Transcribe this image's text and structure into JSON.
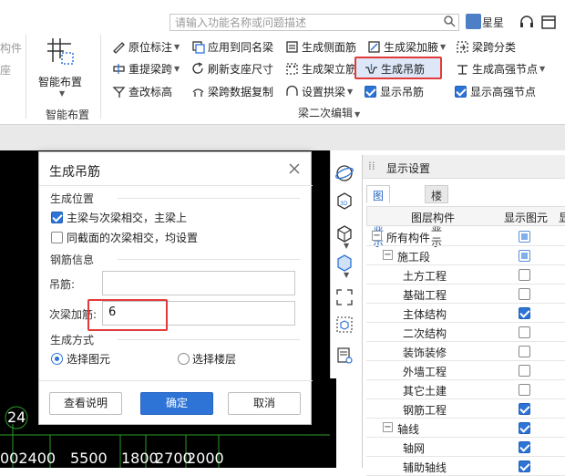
{
  "search": {
    "placeholder": "请输入功能名称或问题描述"
  },
  "user": {
    "name": "星星"
  },
  "ribbon": {
    "left_cut": {
      "line1": "构件",
      "line2": "座"
    },
    "smart_layout": {
      "label": "智能布置",
      "group": "智能布置"
    },
    "col1": [
      "原位标注",
      "重提梁跨",
      "查改标高"
    ],
    "col2": [
      "应用到同名梁",
      "刷新支座尺寸",
      "梁跨数据复制"
    ],
    "col3": [
      "生成侧面筋",
      "生成架立筋",
      "设置拱梁"
    ],
    "col4": [
      "生成梁加腋",
      "生成吊筋",
      "显示吊筋"
    ],
    "col5": [
      "梁跨分类",
      "生成高强节点",
      "显示高强节点"
    ],
    "group_label": "梁二次编辑"
  },
  "panel": {
    "title": "显示设置",
    "tabs": [
      "图元显示",
      "楼层显示"
    ],
    "col_headers": [
      "图层构件",
      "显示图元",
      "显"
    ],
    "rows": [
      {
        "label": "所有构件",
        "state": "partial"
      },
      {
        "label": "施工段",
        "state": "partial"
      },
      {
        "label": "土方工程",
        "state": "unchecked"
      },
      {
        "label": "基础工程",
        "state": "unchecked"
      },
      {
        "label": "主体结构",
        "state": "checked"
      },
      {
        "label": "二次结构",
        "state": "unchecked"
      },
      {
        "label": "装饰装修",
        "state": "unchecked"
      },
      {
        "label": "外墙工程",
        "state": "unchecked"
      },
      {
        "label": "其它土建",
        "state": "unchecked"
      },
      {
        "label": "钢筋工程",
        "state": "checked"
      },
      {
        "label": "轴线",
        "state": "checked"
      },
      {
        "label": "轴网",
        "state": "checked"
      },
      {
        "label": "辅助轴线",
        "state": "checked"
      }
    ]
  },
  "dialog": {
    "title": "生成吊筋",
    "section_position": "生成位置",
    "opt1": "主梁与次梁相交，主梁上",
    "opt2": "同截面的次梁相交，均设置",
    "section_rebar": "钢筋信息",
    "hanger_label": "吊筋:",
    "hanger_value": "",
    "secondary_label": "次梁加筋:",
    "secondary_value": "6",
    "section_method": "生成方式",
    "radio1": "选择图元",
    "radio2": "选择楼层",
    "btn_help": "查看说明",
    "btn_ok": "确定",
    "btn_cancel": "取消"
  },
  "canvas": {
    "axis_label": "24",
    "dims": [
      "002400",
      "5500",
      "1800",
      "2700",
      "2000"
    ]
  }
}
